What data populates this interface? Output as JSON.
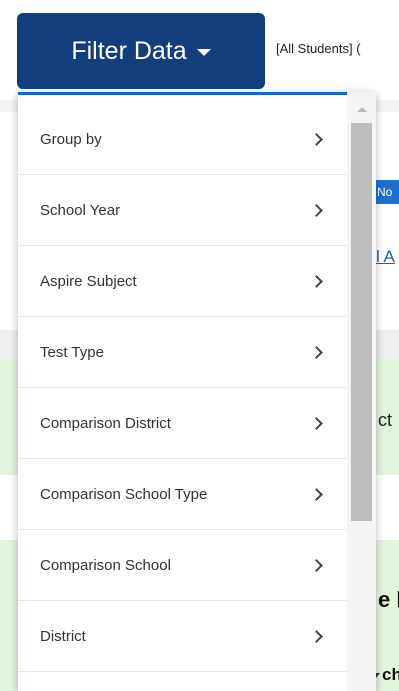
{
  "header": {
    "filter_button_label": "Filter Data",
    "filter_summary": "[All Students] ("
  },
  "background": {
    "badge_fragment": "No",
    "link_fragment": "l A",
    "text_fragment_1": "ct",
    "text_fragment_2": "e l",
    "text_fragment_3": "ch"
  },
  "menu": {
    "items": [
      {
        "label": "Group by"
      },
      {
        "label": "School Year"
      },
      {
        "label": "Aspire Subject"
      },
      {
        "label": "Test Type"
      },
      {
        "label": "Comparison District"
      },
      {
        "label": "Comparison School Type"
      },
      {
        "label": "Comparison School"
      },
      {
        "label": "District"
      }
    ]
  },
  "colors": {
    "button_bg": "#123e7b",
    "accent": "#1565d8",
    "highlight_green": "#e3f4df"
  },
  "icons": {
    "caret": "caret-down-icon",
    "chevron": "chevron-right-icon"
  }
}
